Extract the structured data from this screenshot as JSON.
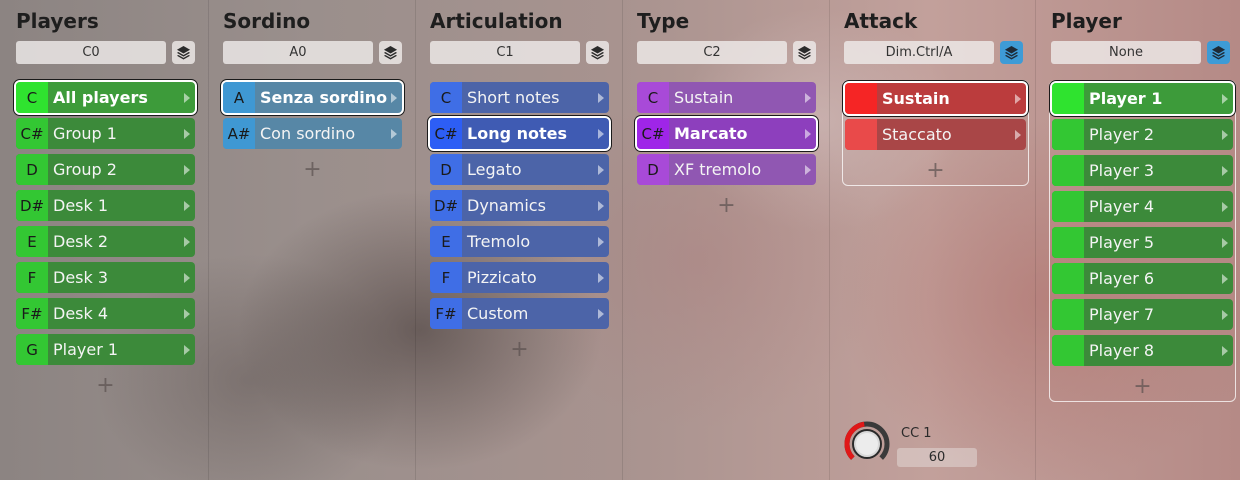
{
  "columns": [
    {
      "title": "Players",
      "selector": "C0",
      "layer_active": false,
      "items": [
        {
          "key": "C",
          "label": "All players",
          "selected": true
        },
        {
          "key": "C#",
          "label": "Group 1"
        },
        {
          "key": "D",
          "label": "Group 2"
        },
        {
          "key": "D#",
          "label": "Desk 1"
        },
        {
          "key": "E",
          "label": "Desk 2"
        },
        {
          "key": "F",
          "label": "Desk 3"
        },
        {
          "key": "F#",
          "label": "Desk 4"
        },
        {
          "key": "G",
          "label": "Player 1"
        }
      ]
    },
    {
      "title": "Sordino",
      "selector": "A0",
      "layer_active": false,
      "items": [
        {
          "key": "A",
          "label": "Senza sordino",
          "selected": true
        },
        {
          "key": "A#",
          "label": "Con sordino"
        }
      ]
    },
    {
      "title": "Articulation",
      "selector": "C1",
      "layer_active": false,
      "items": [
        {
          "key": "C",
          "label": "Short notes"
        },
        {
          "key": "C#",
          "label": "Long notes",
          "selected": true
        },
        {
          "key": "D",
          "label": "Legato"
        },
        {
          "key": "D#",
          "label": "Dynamics"
        },
        {
          "key": "E",
          "label": "Tremolo"
        },
        {
          "key": "F",
          "label": "Pizzicato"
        },
        {
          "key": "F#",
          "label": "Custom"
        }
      ]
    },
    {
      "title": "Type",
      "selector": "C2",
      "layer_active": false,
      "items": [
        {
          "key": "C",
          "label": "Sustain"
        },
        {
          "key": "C#",
          "label": "Marcato",
          "selected": true
        },
        {
          "key": "D",
          "label": "XF tremolo"
        }
      ]
    },
    {
      "title": "Attack",
      "selector": "Dim.Ctrl/A",
      "layer_active": true,
      "items": [
        {
          "key": "",
          "label": "Sustain",
          "selected": true
        },
        {
          "key": "",
          "label": "Staccato"
        }
      ]
    },
    {
      "title": "Player",
      "selector": "None",
      "layer_active": true,
      "items": [
        {
          "key": "",
          "label": "Player 1",
          "selected": true
        },
        {
          "key": "",
          "label": "Player 2"
        },
        {
          "key": "",
          "label": "Player 3"
        },
        {
          "key": "",
          "label": "Player 4"
        },
        {
          "key": "",
          "label": "Player 5"
        },
        {
          "key": "",
          "label": "Player 6"
        },
        {
          "key": "",
          "label": "Player 7"
        },
        {
          "key": "",
          "label": "Player 8"
        }
      ]
    }
  ],
  "add_symbol": "+",
  "controller": {
    "label": "CC 1",
    "value": "60",
    "level": 0.47
  },
  "icons": {
    "layer": "layers-icon",
    "arrow": "chevron-right-icon",
    "knob": "knob-icon"
  },
  "colors": {
    "players": "#33c733",
    "sordino": "#3f98d3",
    "articulation": "#3f6ee6",
    "type": "#a84ad8",
    "attack": "#e94a4a",
    "player": "#33c733",
    "layer_active": "#3e9bd6"
  }
}
